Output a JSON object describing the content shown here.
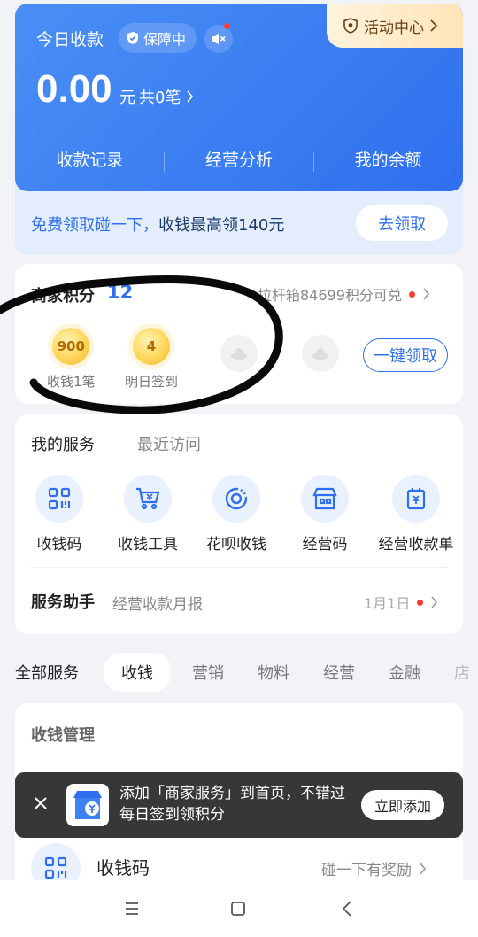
{
  "header": {
    "title": "今日收款",
    "shield_chip": "保障中",
    "activity": "活动中心",
    "amount": "0.00",
    "amount_unit": "元",
    "amount_count": "共0笔",
    "nav": [
      "收款记录",
      "经营分析",
      "我的余额"
    ]
  },
  "promo": {
    "text_prefix": "免费领取碰一下，",
    "text_suffix": "收钱最高领140元",
    "button": "去领取"
  },
  "points": {
    "label": "商家积分",
    "value": "12",
    "exchange": "拉杆箱84699积分可兑",
    "coins": [
      {
        "value": "900",
        "caption": "收钱1笔"
      },
      {
        "value": "4",
        "caption": "明日签到"
      }
    ],
    "claim_button": "一键领取"
  },
  "services": {
    "tab_mine": "我的服务",
    "tab_recent": "最近访问",
    "items": [
      {
        "label": "收钱码",
        "icon": "qr-code-icon"
      },
      {
        "label": "收钱工具",
        "icon": "cart-icon"
      },
      {
        "label": "花呗收钱",
        "icon": "huabei-icon"
      },
      {
        "label": "经营码",
        "icon": "store-icon"
      },
      {
        "label": "经营收款单",
        "icon": "receipt-icon"
      }
    ],
    "assistant_label": "服务助手",
    "assistant_sub": "经营收款月报",
    "assistant_date": "1月1日"
  },
  "categories": [
    "全部服务",
    "收钱",
    "营销",
    "物料",
    "经营",
    "金融",
    "店"
  ],
  "management": {
    "title": "收钱管理",
    "row_label": "收钱码",
    "row_right": "碰一下有奖励"
  },
  "toast": {
    "text": "添加「商家服务」到首页，不错过每日签到领积分",
    "button": "立即添加"
  },
  "colors": {
    "primary": "#2f6fef",
    "coin": "#ffd65a",
    "alert": "#ff3b30"
  }
}
